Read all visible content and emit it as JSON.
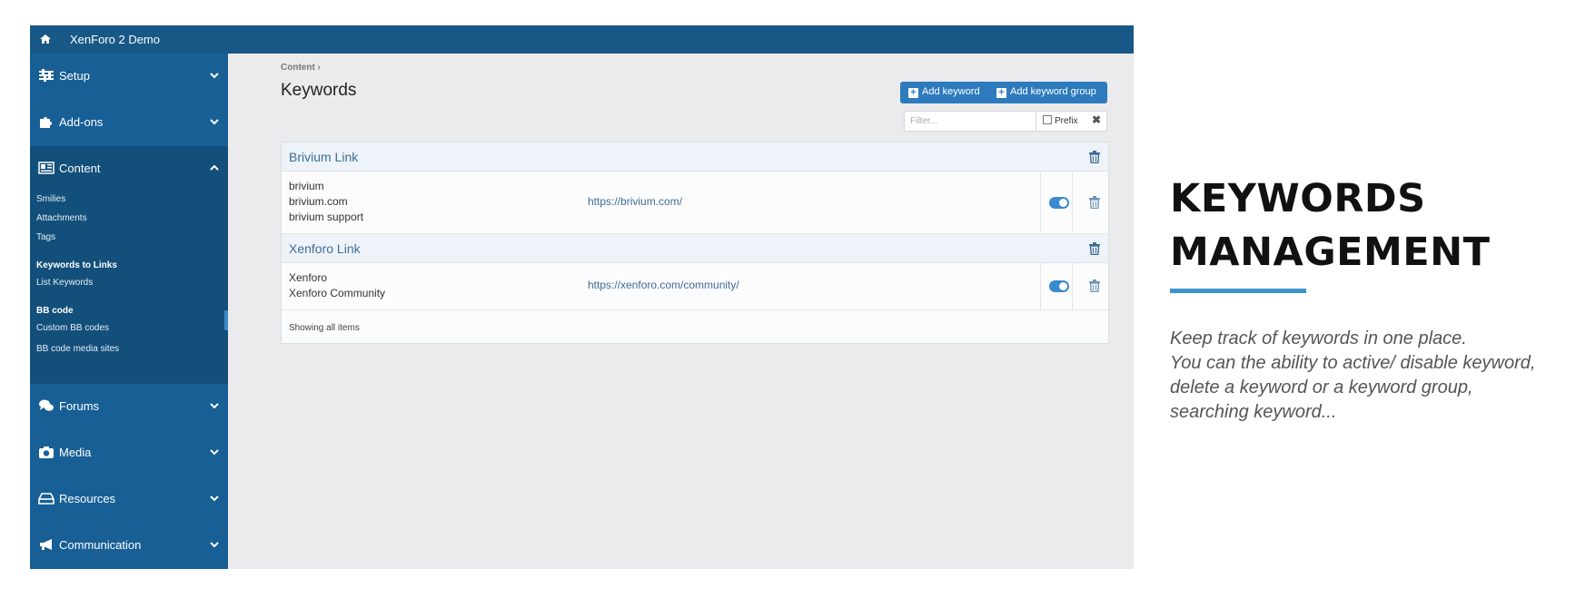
{
  "app": {
    "title": "XenForo 2 Demo"
  },
  "sidebar": {
    "sections": [
      {
        "label": "Setup",
        "icon": "sliders-icon",
        "state": "collapsed"
      },
      {
        "label": "Add-ons",
        "icon": "puzzle-icon",
        "state": "collapsed"
      },
      {
        "label": "Content",
        "icon": "newspaper-icon",
        "state": "expanded"
      },
      {
        "label": "Forums",
        "icon": "comments-icon",
        "state": "collapsed"
      },
      {
        "label": "Media",
        "icon": "camera-icon",
        "state": "collapsed"
      },
      {
        "label": "Resources",
        "icon": "hdd-icon",
        "state": "collapsed"
      },
      {
        "label": "Communication",
        "icon": "bullhorn-icon",
        "state": "collapsed"
      }
    ],
    "content_items": [
      {
        "label": "Smilies",
        "type": "link"
      },
      {
        "label": "Attachments",
        "type": "link"
      },
      {
        "label": "Tags",
        "type": "link"
      },
      {
        "label": "Keywords to Links",
        "type": "header"
      },
      {
        "label": "List Keywords",
        "type": "link",
        "active": true
      },
      {
        "label": "BB code",
        "type": "header"
      },
      {
        "label": "Custom BB codes",
        "type": "link"
      },
      {
        "label": "BB code media sites",
        "type": "link"
      }
    ]
  },
  "main": {
    "breadcrumb": "Content",
    "title": "Keywords",
    "buttons": {
      "add_keyword": "Add keyword",
      "add_keyword_group": "Add keyword group"
    },
    "filter": {
      "placeholder": "Filter...",
      "prefix_label": "Prefix",
      "prefix_checked": false
    },
    "groups": [
      {
        "name": "Brivium Link",
        "keywords": [
          "brivium",
          "brivium.com",
          "brivium support"
        ],
        "url": "https://brivium.com/",
        "enabled": true
      },
      {
        "name": "Xenforo Link",
        "keywords": [
          "Xenforo",
          "Xenforo Community"
        ],
        "url": "https://xenforo.com/community/",
        "enabled": true
      }
    ],
    "status": "Showing all items"
  },
  "promo": {
    "title_line1": "KEYWORDS",
    "title_line2": "MANAGEMENT",
    "description": [
      "Keep track of keywords in one place.",
      "You can the ability to active/ disable keyword,",
      "delete a keyword or a keyword group,",
      "searching keyword..."
    ]
  },
  "colors": {
    "topbar": "#185886",
    "sidebar": "#175f95",
    "sidebar_expanded": "#134f7b",
    "accent": "#2d7bbd",
    "toggle_on": "#3a8ad0",
    "promo_line": "#3c94c9"
  }
}
